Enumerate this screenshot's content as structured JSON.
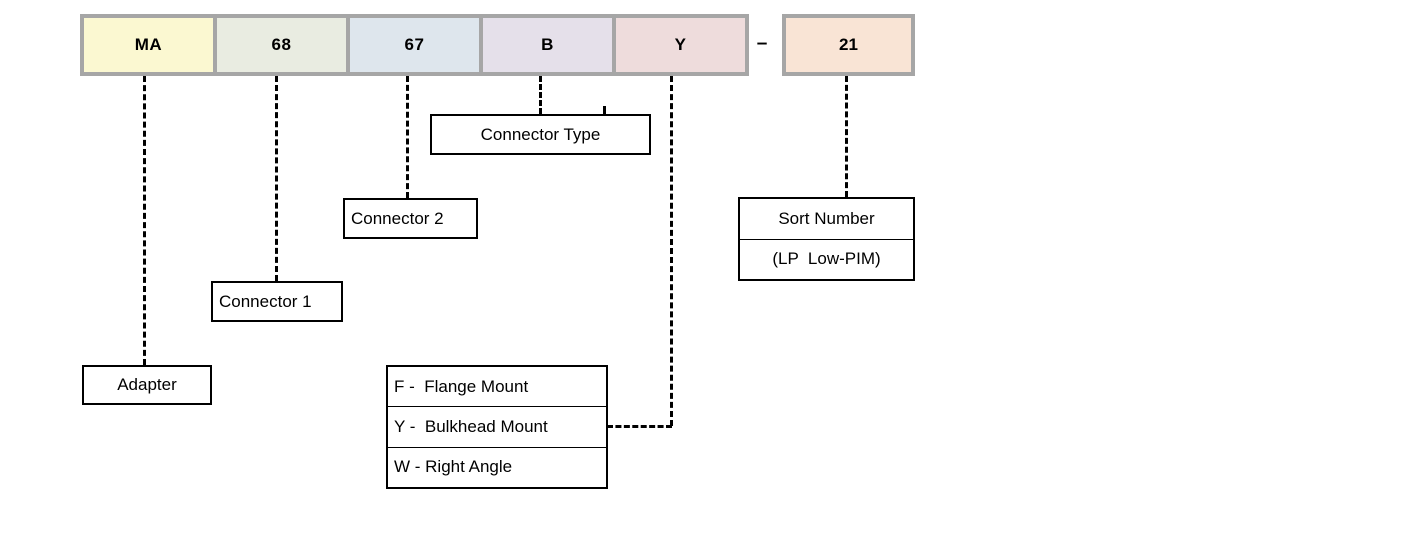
{
  "part_number": {
    "segments": [
      {
        "value": "MA",
        "color": "#fbf8d1",
        "width": 129
      },
      {
        "value": "68",
        "color": "#e9ece1",
        "width": 129
      },
      {
        "value": "67",
        "color": "#dee6ed",
        "width": 129
      },
      {
        "value": "B",
        "color": "#e5e0ea",
        "width": 129
      },
      {
        "value": "Y",
        "color": "#eedcdc",
        "width": 129
      }
    ],
    "separator": "–",
    "tail": {
      "value": "21",
      "color": "#f9e4d5"
    }
  },
  "callouts": {
    "adapter": {
      "lines": [
        "Adapter"
      ]
    },
    "connector_1": {
      "lines": [
        "Connector 1"
      ]
    },
    "connector_2": {
      "lines": [
        "Connector 2"
      ]
    },
    "connector_type": {
      "lines": [
        "Connector Type"
      ]
    },
    "mount_options": {
      "lines": [
        "F -  Flange Mount",
        "Y -  Bulkhead Mount",
        "W - Right Angle"
      ]
    },
    "sort_number": {
      "lines": [
        "Sort Number",
        "(LP  Low-PIM)"
      ]
    }
  },
  "colors": {
    "strip_border": "#a6a6a6",
    "callout_border": "#000000",
    "connector_line": "#000000",
    "background": "#ffffff"
  }
}
